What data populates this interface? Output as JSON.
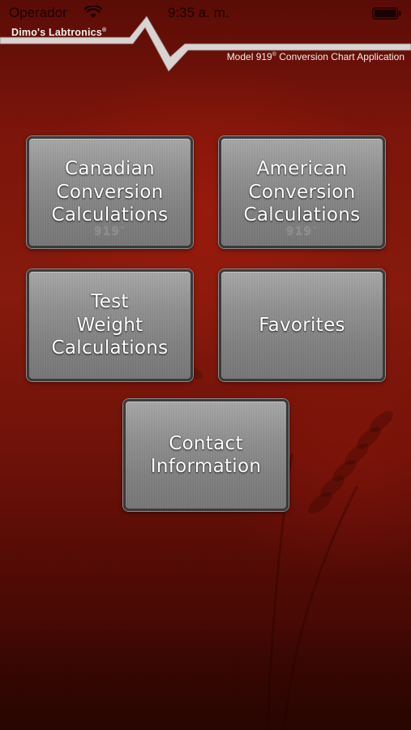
{
  "status_bar": {
    "carrier": "Operador",
    "time": "9:35 a. m.",
    "wifi_icon": "wifi-icon",
    "battery_icon": "battery-icon"
  },
  "header": {
    "brand": "Dimo's Labtronics",
    "brand_mark": "®",
    "subtitle_model": "Model 919",
    "subtitle_mark": "®",
    "subtitle_rest": " Conversion Chart Application"
  },
  "menu": {
    "canadian": {
      "label": "Canadian\nConversion\nCalculations",
      "watermark": "919",
      "watermark_mark": "™"
    },
    "american": {
      "label": "American\nConversion\nCalculations",
      "watermark": "919",
      "watermark_mark": "™"
    },
    "test_weight": {
      "label": "Test\nWeight\nCalculations"
    },
    "favorites": {
      "label": "Favorites"
    },
    "contact": {
      "label": "Contact\nInformation"
    }
  },
  "colors": {
    "background": "#7c150b",
    "button": "#8f8f8f",
    "button_border": "#3a3a3a",
    "header_line": "#d9d4d2"
  }
}
